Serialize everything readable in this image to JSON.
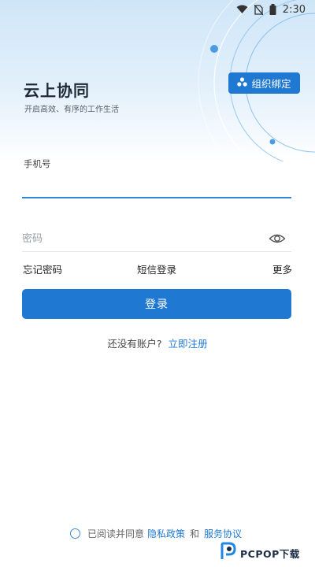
{
  "status_bar": {
    "time": "2:30",
    "icons": [
      "wifi-icon",
      "no-sim-icon",
      "battery-icon"
    ]
  },
  "header": {
    "title": "云上协同",
    "subtitle": "开启高效、有序的工作生活",
    "org_bind_label": "组织绑定",
    "org_bind_icon": "org-bind-icon"
  },
  "form": {
    "phone_label": "手机号",
    "phone_value": "",
    "password_placeholder": "密码",
    "password_value": "",
    "eye_icon": "eye-icon"
  },
  "links": {
    "forgot_password": "忘记密码",
    "sms_login": "短信登录",
    "more": "更多"
  },
  "login_button_label": "登录",
  "register": {
    "question": "还没有账户?",
    "link": "立即注册"
  },
  "agreement": {
    "prefix": "已阅读并同意",
    "privacy": "隐私政策",
    "and": "和",
    "service": "服务协议",
    "checked": false
  },
  "watermark": {
    "text": "PCPOP下载"
  },
  "colors": {
    "primary": "#1f78d1",
    "input_active": "#2f86d6",
    "hero_top": "#cfe6f8"
  }
}
